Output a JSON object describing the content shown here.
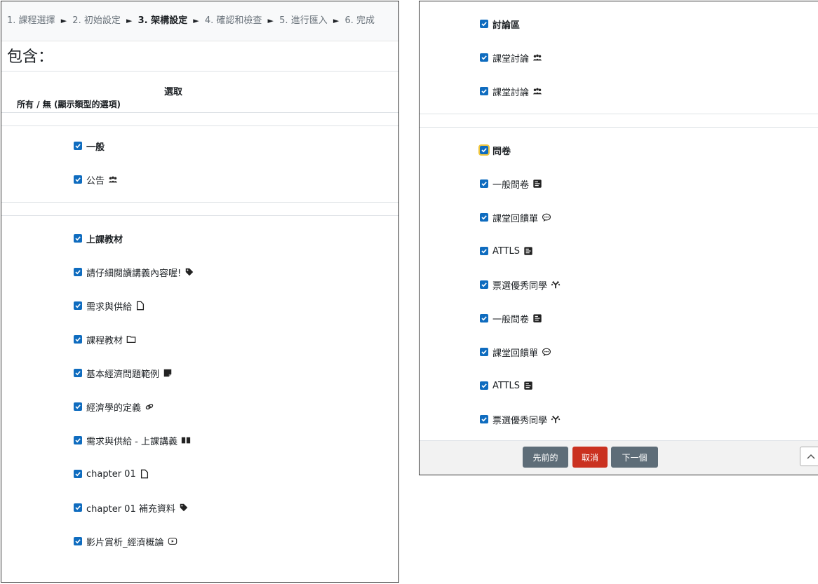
{
  "breadcrumb": {
    "steps": [
      "1. 課程選擇",
      "2. 初始設定",
      "3. 架構設定",
      "4. 確認和檢查",
      "5. 進行匯入",
      "6. 完成"
    ],
    "separator": "►",
    "active_index": 2
  },
  "include_title": "包含：",
  "select_header": {
    "title": "選取",
    "link_all": "所有",
    "slash": " / ",
    "link_none": "無",
    "link_types": "(顯示類型的選項)"
  },
  "left_sections": [
    {
      "title": "一般",
      "items": [
        {
          "label": "公告",
          "icon": "forum-icon"
        }
      ]
    },
    {
      "title": "上課教材",
      "items": [
        {
          "label": "請仔細閱讀講義內容喔!",
          "icon": "tag-icon"
        },
        {
          "label": "需求與供給",
          "icon": "file-icon"
        },
        {
          "label": "課程教材",
          "icon": "folder-icon"
        },
        {
          "label": "基本經濟問題範例",
          "icon": "note-icon"
        },
        {
          "label": "經濟學的定義",
          "icon": "link-icon"
        },
        {
          "label": "需求與供給 - 上課講義",
          "icon": "book-icon"
        },
        {
          "label": "chapter 01",
          "icon": "file-icon"
        },
        {
          "label": "chapter 01 補充資料",
          "icon": "tag-icon"
        },
        {
          "label": "影片賞析_經濟概論",
          "icon": "video-icon"
        }
      ]
    }
  ],
  "right_sections": [
    {
      "title": "討論區",
      "items": [
        {
          "label": "課堂討論",
          "icon": "forum-icon"
        },
        {
          "label": "課堂討論",
          "icon": "forum-icon"
        }
      ]
    },
    {
      "title": "問卷",
      "items": [
        {
          "label": "一般問卷",
          "icon": "survey-icon"
        },
        {
          "label": "課堂回饋單",
          "icon": "feedback-icon"
        },
        {
          "label": "ATTLS",
          "icon": "survey-icon"
        },
        {
          "label": "票選優秀同學",
          "icon": "choice-icon"
        },
        {
          "label": "一般問卷",
          "icon": "survey-icon"
        },
        {
          "label": "課堂回饋單",
          "icon": "feedback-icon"
        },
        {
          "label": "ATTLS",
          "icon": "survey-icon"
        },
        {
          "label": "票選優秀同學",
          "icon": "choice-icon"
        }
      ]
    }
  ],
  "buttons": {
    "prev": "先前的",
    "cancel": "取消",
    "next": "下一個"
  },
  "colors": {
    "checkbox": "#0f6cbf",
    "btn_secondary": "#5e6d78",
    "btn_danger": "#ca3120",
    "focus": "#f0c63e"
  }
}
